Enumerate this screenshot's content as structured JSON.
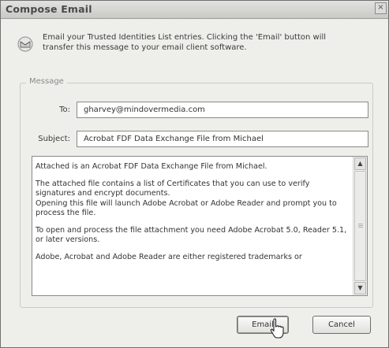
{
  "window": {
    "title": "Compose Email",
    "close_glyph": "×"
  },
  "info": {
    "icon": "email-icon",
    "text": "Email your Trusted Identities List entries. Clicking the 'Email' button will transfer this message to your email client software."
  },
  "message_group": {
    "legend": "Message",
    "to_label": "To:",
    "to_value": "gharvey@mindovermedia.com",
    "subject_label": "Subject:",
    "subject_value": "Acrobat FDF Data Exchange File from Michael",
    "body": [
      "Attached is an Acrobat FDF Data Exchange File from Michael.",
      "The attached file contains a list of Certificates that you can use to verify signatures and encrypt documents.",
      "Opening this file will launch Adobe Acrobat or Adobe Reader and prompt you to process the file.",
      "To open and process the file attachment you need Adobe Acrobat 5.0, Reader 5.1, or later versions.",
      "Adobe, Acrobat and Adobe Reader are either registered trademarks or"
    ],
    "scroll_up_glyph": "▲",
    "scroll_down_glyph": "▼"
  },
  "buttons": {
    "email": "Email",
    "cancel": "Cancel"
  }
}
